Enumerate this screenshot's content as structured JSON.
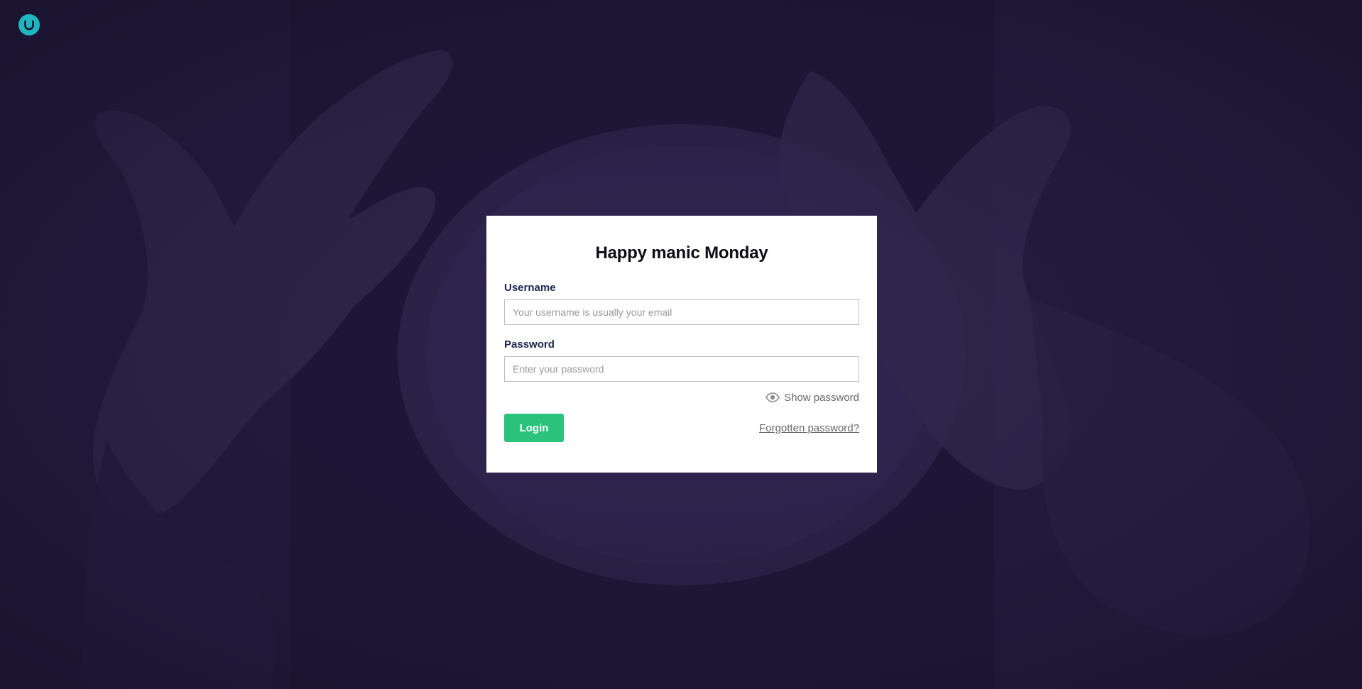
{
  "colors": {
    "background": "#1d1534",
    "logo": "#1fb6bf",
    "login_button": "#2bc37c",
    "card": "#ffffff"
  },
  "logo": {
    "icon": "umbraco-logo-icon"
  },
  "login": {
    "title": "Happy manic Monday",
    "username_label": "Username",
    "username_value": "",
    "username_placeholder": "Your username is usually your email",
    "password_label": "Password",
    "password_value": "",
    "password_placeholder": "Enter your password",
    "show_password_label": "Show password",
    "show_password_icon": "eye-icon",
    "login_button_label": "Login",
    "forgot_password_label": "Forgotten password?"
  }
}
